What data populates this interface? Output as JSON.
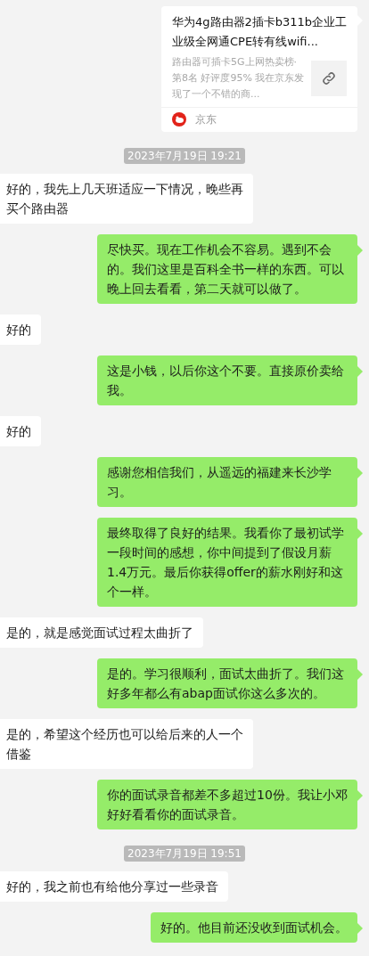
{
  "messages": [
    {
      "kind": "link_card",
      "title": "华为4g路由器2插卡b311b企业工业级全网通CPE转有线wifi...",
      "description": "路由器可插卡5G上网热卖榜·第8名 好评度95% 我在京东发现了一个不错的商...",
      "source": "京东"
    },
    {
      "kind": "time",
      "text": "2023年7月19日 19:21"
    },
    {
      "kind": "received",
      "text": "好的，我先上几天班适应一下情况，晚些再买个路由器"
    },
    {
      "kind": "sent",
      "text": "尽快买。现在工作机会不容易。遇到不会的。我们这里是百科全书一样的东西。可以晚上回去看看，第二天就可以做了。"
    },
    {
      "kind": "received",
      "text": "好的"
    },
    {
      "kind": "sent",
      "text": "这是小钱，以后你这个不要。直接原价卖给我。"
    },
    {
      "kind": "received",
      "text": "好的"
    },
    {
      "kind": "sent",
      "text": "感谢您相信我们，从遥远的福建来长沙学习。"
    },
    {
      "kind": "sent",
      "text": "最终取得了良好的结果。我看你了最初试学一段时间的感想，你中间提到了假设月薪1.4万元。最后你获得offer的薪水刚好和这个一样。"
    },
    {
      "kind": "received",
      "text": "是的，就是感觉面试过程太曲折了"
    },
    {
      "kind": "sent",
      "text": "是的。学习很顺利，面试太曲折了。我们这好多年都么有abap面试你这么多次的。"
    },
    {
      "kind": "received",
      "text": "是的，希望这个经历也可以给后来的人一个借鉴"
    },
    {
      "kind": "sent",
      "text": "你的面试录音都差不多超过10份。我让小邓好好看看你的面试录音。"
    },
    {
      "kind": "time",
      "text": "2023年7月19日 19:51"
    },
    {
      "kind": "received",
      "text": "好的，我之前也有给他分享过一些录音"
    },
    {
      "kind": "sent",
      "text": "好的。他目前还没收到面试机会。"
    }
  ]
}
